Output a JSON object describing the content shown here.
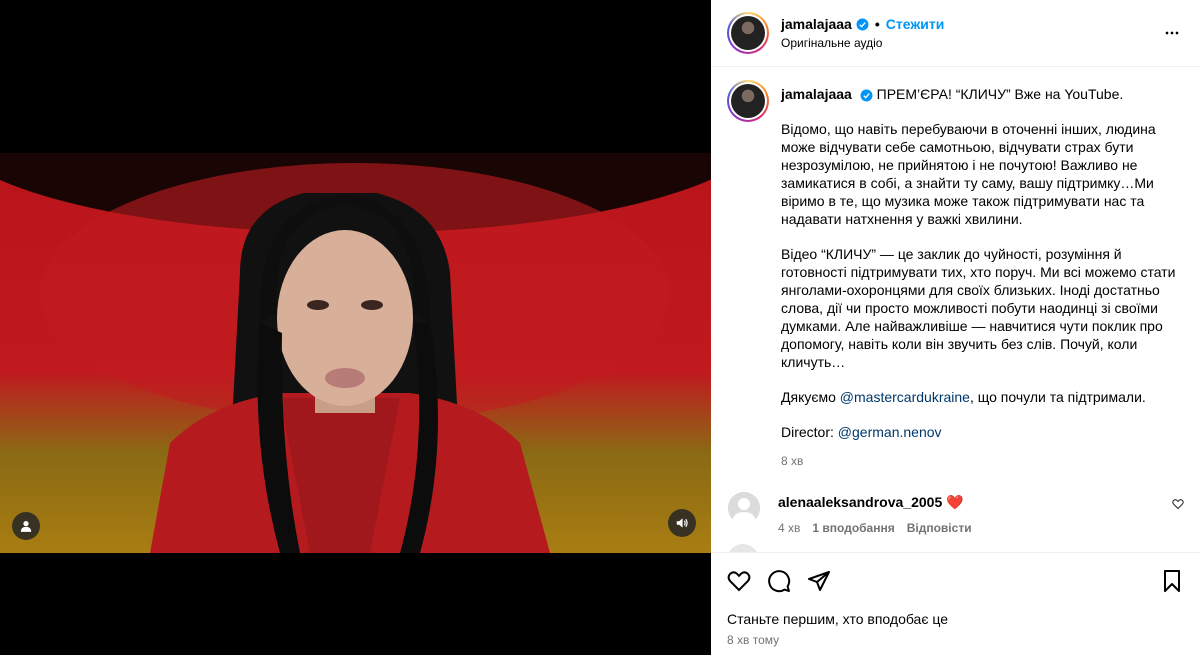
{
  "post": {
    "username": "jamalajaaa",
    "follow_label": "Стежити",
    "separator": "•",
    "audio_label": "Оригінальне аудіо"
  },
  "caption": {
    "username": "jamalajaaa",
    "first_line": "ПРЕМ’ЄРА! “КЛИЧУ” Вже на YouTube.",
    "paragraph1": "Відомо, що навіть перебуваючи в оточенні інших, людина може відчувати себе самотньою, відчувати страх бути незрозумілою, не прийнятою і не почутою! Важливо не замикатися в собі, а знайти ту саму, вашу підтримку…Ми віримо в те, що музика може також підтримувати нас та надавати натхнення у важкі хвилини.",
    "paragraph2": "Відео “КЛИЧУ” — це заклик до чуйності, розуміння й готовності підтримувати тих, хто поруч. Ми всі можемо стати янголами-охоронцями для своїх близьких. Іноді достатньо слова, дії чи просто можливості побути наодинці зі своїми думками. Але найважливіше — навчитися чути поклик про допомогу, навіть коли він звучить без слів. Почуй, коли кличуть…",
    "thanks_prefix": "Дякуємо ",
    "thanks_mention": "@mastercardukraine",
    "thanks_suffix": ", що почули та підтримали.",
    "director_prefix": "Director: ",
    "director_mention": "@german.nenov",
    "time": "8 хв"
  },
  "comments": [
    {
      "username": "alenaaleksandrova_2005",
      "text": "❤️",
      "time": "4 хв",
      "likes": "1 вподобання",
      "reply": "Відповісти"
    }
  ],
  "footer": {
    "likes_text": "Станьте першим, хто вподобає це",
    "time": "8 хв тому"
  },
  "icons": {
    "verified": "verified-badge-icon",
    "more": "more-options-icon",
    "like": "heart-icon",
    "comment": "comment-icon",
    "share": "share-icon",
    "save": "bookmark-icon",
    "tag": "user-tag-icon",
    "sound": "sound-icon"
  },
  "colors": {
    "link": "#0095f6",
    "mention": "#00376b",
    "secondary_text": "#737373",
    "heart_red": "#ed4956"
  }
}
